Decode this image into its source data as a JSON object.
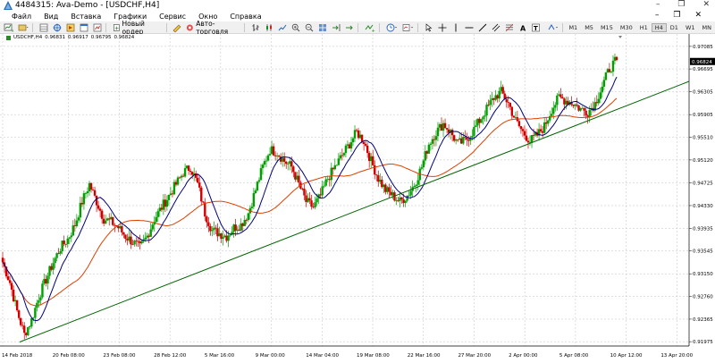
{
  "window": {
    "title": "4484315: Ava-Demo - [USDCHF,H4]",
    "minimize": "–",
    "restore": "❐",
    "close": "✕"
  },
  "menu": {
    "items": [
      "Файл",
      "Вид",
      "Вставка",
      "Графики",
      "Сервис",
      "Окно",
      "Справка"
    ],
    "right_minimize": "–",
    "right_restore": "❐",
    "right_close": "✕"
  },
  "toolbar": {
    "new_order": "Новый ордер",
    "autotrading": "Авто-торговля",
    "timeframes": [
      "M1",
      "M5",
      "M15",
      "M30",
      "H1",
      "H4",
      "D1",
      "W1",
      "MN"
    ],
    "active_timeframe": "H4"
  },
  "chart": {
    "symbol_label": "USDCHF,H4",
    "ohlc": [
      "0.96831",
      "0.96917",
      "0.96795",
      "0.96824"
    ],
    "current_price": "0.96824",
    "price_labels": [
      "0.97085",
      "0.96695",
      "0.96305",
      "0.95905",
      "0.95510",
      "0.95120",
      "0.94725",
      "0.94330",
      "0.93935",
      "0.93545",
      "0.93150",
      "0.92760",
      "0.92365",
      "0.91975"
    ],
    "time_labels": [
      "14 Feb 2018",
      "20 Feb 08:00",
      "23 Feb 08:00",
      "28 Feb 12:00",
      "5 Mar 16:00",
      "9 Mar 00:00",
      "14 Mar 04:00",
      "19 Mar 08:00",
      "22 Mar 16:00",
      "27 Mar 20:00",
      "2 Apr 00:00",
      "5 Apr 08:00",
      "10 Apr 12:00",
      "13 Apr 20:00"
    ],
    "colors": {
      "bull": "#00a000",
      "bear": "#d00000",
      "ma_fast": "#000080",
      "ma_slow": "#e04000",
      "trendline": "#006400",
      "grid": "#c0c0c0",
      "price_marker_bg": "#000000"
    }
  },
  "chart_data": {
    "type": "candlestick",
    "symbol": "USDCHF",
    "timeframe": "H4",
    "ylim": [
      0.919,
      0.973
    ],
    "close_path": [
      0.9335,
      0.93,
      0.925,
      0.921,
      0.9235,
      0.9275,
      0.9305,
      0.9335,
      0.936,
      0.9375,
      0.94,
      0.944,
      0.947,
      0.944,
      0.941,
      0.9405,
      0.9395,
      0.938,
      0.937,
      0.936,
      0.938,
      0.941,
      0.943,
      0.945,
      0.947,
      0.949,
      0.95,
      0.947,
      0.942,
      0.939,
      0.9385,
      0.938,
      0.9395,
      0.94,
      0.942,
      0.946,
      0.95,
      0.953,
      0.9525,
      0.951,
      0.95,
      0.947,
      0.944,
      0.943,
      0.945,
      0.948,
      0.95,
      0.952,
      0.954,
      0.956,
      0.9545,
      0.951,
      0.948,
      0.946,
      0.945,
      0.944,
      0.945,
      0.947,
      0.95,
      0.954,
      0.956,
      0.9575,
      0.956,
      0.954,
      0.9545,
      0.956,
      0.958,
      0.96,
      0.962,
      0.963,
      0.961,
      0.958,
      0.956,
      0.9545,
      0.9555,
      0.957,
      0.96,
      0.962,
      0.9615,
      0.961,
      0.96,
      0.9595,
      0.961,
      0.964,
      0.967,
      0.9685
    ]
  }
}
